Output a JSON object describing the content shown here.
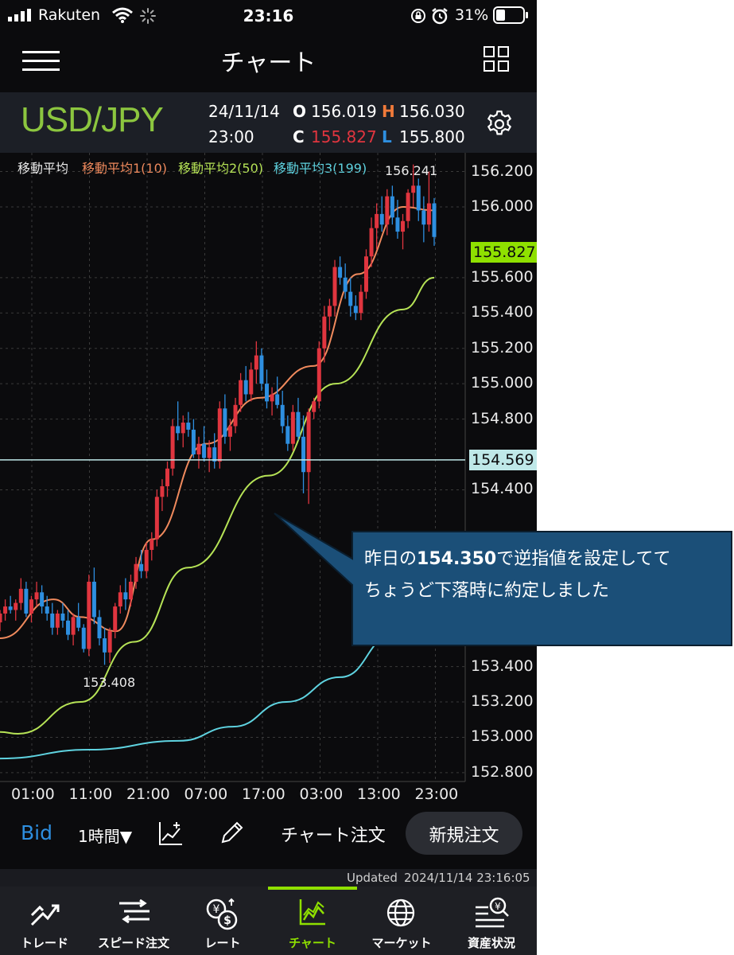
{
  "status": {
    "carrier": "Rakuten",
    "time": "23:16",
    "battery": "31%"
  },
  "header": {
    "title": "チャート"
  },
  "quote": {
    "pair": "USD/JPY",
    "date": "24/11/14",
    "time": "23:00",
    "open_label": "O",
    "open": "156.019",
    "high_label": "H",
    "high": "156.030",
    "close_label": "C",
    "close": "155.827",
    "low_label": "L",
    "low": "155.800"
  },
  "legend": {
    "title": "移動平均",
    "ma1": "移動平均1(10)",
    "ma2": "移動平均2(50)",
    "ma3": "移動平均3(199)"
  },
  "colors": {
    "up": "#e0353f",
    "down": "#2e8fe0",
    "ma1": "#f08a5d",
    "ma2": "#b6e356",
    "ma3": "#5fd3e0",
    "accent": "#8cc63f"
  },
  "chart_data": {
    "type": "candlestick",
    "y_ticks": [
      "156.200",
      "156.000",
      "155.600",
      "155.400",
      "155.200",
      "155.000",
      "154.800",
      "154.400",
      "153.400",
      "153.200",
      "153.000",
      "152.800"
    ],
    "x_ticks": [
      "01:00",
      "11:00",
      "21:00",
      "07:00",
      "17:00",
      "03:00",
      "13:00",
      "23:00"
    ],
    "ylim": [
      152.75,
      156.27
    ],
    "high_label": "156.241",
    "low_label": "153.408",
    "current_price": "155.827",
    "line_price": "154.569",
    "line_price_value": 154.569,
    "candles": [
      [
        153.65,
        153.72,
        153.6,
        153.7
      ],
      [
        153.7,
        153.78,
        153.66,
        153.74
      ],
      [
        153.74,
        153.8,
        153.7,
        153.72
      ],
      [
        153.72,
        153.78,
        153.66,
        153.76
      ],
      [
        153.76,
        153.9,
        153.72,
        153.84
      ],
      [
        153.84,
        153.88,
        153.68,
        153.7
      ],
      [
        153.7,
        153.8,
        153.65,
        153.78
      ],
      [
        153.78,
        153.88,
        153.74,
        153.82
      ],
      [
        153.82,
        153.86,
        153.7,
        153.74
      ],
      [
        153.74,
        153.8,
        153.66,
        153.7
      ],
      [
        153.7,
        153.76,
        153.58,
        153.62
      ],
      [
        153.62,
        153.72,
        153.58,
        153.7
      ],
      [
        153.7,
        153.76,
        153.62,
        153.66
      ],
      [
        153.66,
        153.72,
        153.55,
        153.58
      ],
      [
        153.58,
        153.7,
        153.52,
        153.68
      ],
      [
        153.68,
        153.76,
        153.6,
        153.62
      ],
      [
        153.62,
        153.64,
        153.48,
        153.5
      ],
      [
        153.5,
        153.92,
        153.46,
        153.88
      ],
      [
        153.88,
        153.96,
        153.64,
        153.68
      ],
      [
        153.68,
        153.72,
        153.52,
        153.56
      ],
      [
        153.56,
        153.62,
        153.41,
        153.48
      ],
      [
        153.48,
        153.62,
        153.42,
        153.6
      ],
      [
        153.6,
        153.76,
        153.56,
        153.74
      ],
      [
        153.74,
        153.86,
        153.7,
        153.82
      ],
      [
        153.82,
        153.9,
        153.72,
        153.78
      ],
      [
        153.78,
        153.92,
        153.74,
        153.88
      ],
      [
        153.88,
        154.02,
        153.84,
        153.98
      ],
      [
        153.98,
        154.06,
        153.9,
        153.94
      ],
      [
        153.94,
        154.1,
        153.9,
        154.06
      ],
      [
        154.06,
        154.16,
        154.0,
        154.12
      ],
      [
        154.12,
        154.4,
        154.08,
        154.36
      ],
      [
        154.36,
        154.46,
        154.28,
        154.42
      ],
      [
        154.42,
        154.56,
        154.36,
        154.52
      ],
      [
        154.52,
        154.8,
        154.48,
        154.76
      ],
      [
        154.76,
        154.9,
        154.68,
        154.72
      ],
      [
        154.72,
        154.82,
        154.64,
        154.78
      ],
      [
        154.78,
        154.84,
        154.7,
        154.74
      ],
      [
        154.74,
        154.8,
        154.58,
        154.6
      ],
      [
        154.6,
        154.7,
        154.52,
        154.66
      ],
      [
        154.66,
        154.76,
        154.56,
        154.58
      ],
      [
        154.58,
        154.68,
        154.5,
        154.64
      ],
      [
        154.64,
        154.72,
        154.52,
        154.56
      ],
      [
        154.56,
        154.9,
        154.52,
        154.86
      ],
      [
        154.86,
        154.94,
        154.66,
        154.7
      ],
      [
        154.7,
        154.8,
        154.62,
        154.76
      ],
      [
        154.76,
        154.92,
        154.72,
        154.88
      ],
      [
        154.88,
        155.06,
        154.84,
        155.02
      ],
      [
        155.02,
        155.1,
        154.9,
        154.94
      ],
      [
        154.94,
        155.12,
        154.9,
        155.08
      ],
      [
        155.08,
        155.24,
        155.0,
        155.16
      ],
      [
        155.16,
        155.2,
        154.96,
        155.0
      ],
      [
        155.0,
        155.08,
        154.86,
        154.9
      ],
      [
        154.9,
        154.98,
        154.82,
        154.94
      ],
      [
        154.94,
        155.04,
        154.86,
        154.88
      ],
      [
        154.88,
        154.96,
        154.72,
        154.76
      ],
      [
        154.76,
        154.82,
        154.62,
        154.66
      ],
      [
        154.66,
        154.88,
        154.62,
        154.84
      ],
      [
        154.84,
        154.92,
        154.68,
        154.7
      ],
      [
        154.7,
        154.82,
        154.38,
        154.5
      ],
      [
        154.5,
        154.86,
        154.32,
        154.84
      ],
      [
        154.84,
        154.92,
        154.8,
        154.9
      ],
      [
        154.9,
        155.24,
        154.86,
        155.2
      ],
      [
        155.2,
        155.44,
        155.12,
        155.38
      ],
      [
        155.38,
        155.48,
        155.3,
        155.44
      ],
      [
        155.44,
        155.7,
        155.38,
        155.66
      ],
      [
        155.66,
        155.72,
        155.56,
        155.6
      ],
      [
        155.6,
        155.68,
        155.48,
        155.52
      ],
      [
        155.52,
        155.6,
        155.38,
        155.44
      ],
      [
        155.44,
        155.5,
        155.36,
        155.4
      ],
      [
        155.4,
        155.56,
        155.36,
        155.52
      ],
      [
        155.52,
        155.76,
        155.48,
        155.72
      ],
      [
        155.72,
        155.94,
        155.66,
        155.88
      ],
      [
        155.88,
        156.02,
        155.76,
        155.96
      ],
      [
        155.96,
        156.06,
        155.86,
        155.9
      ],
      [
        155.9,
        156.1,
        155.84,
        156.06
      ],
      [
        156.06,
        156.12,
        155.9,
        155.94
      ],
      [
        155.94,
        156.04,
        155.82,
        155.86
      ],
      [
        155.86,
        155.96,
        155.76,
        155.92
      ],
      [
        155.92,
        156.1,
        155.88,
        156.08
      ],
      [
        156.08,
        156.24,
        156.0,
        156.12
      ],
      [
        156.12,
        156.16,
        155.92,
        155.98
      ],
      [
        155.98,
        156.06,
        155.8,
        155.9
      ],
      [
        155.9,
        156.2,
        155.86,
        156.02
      ],
      [
        156.02,
        156.05,
        155.78,
        155.83
      ]
    ],
    "ma1": [
      [
        0,
        153.56
      ],
      [
        12,
        153.78
      ],
      [
        18,
        153.68
      ],
      [
        26,
        153.6
      ],
      [
        34,
        154.12
      ],
      [
        46,
        154.66
      ],
      [
        58,
        154.92
      ],
      [
        70,
        155.1
      ],
      [
        80,
        155.62
      ],
      [
        90,
        156.0
      ],
      [
        97,
        155.98
      ]
    ],
    "ma2": [
      [
        0,
        153.03
      ],
      [
        4,
        153.02
      ],
      [
        18,
        153.2
      ],
      [
        30,
        153.54
      ],
      [
        42,
        153.96
      ],
      [
        60,
        154.48
      ],
      [
        75,
        155.0
      ],
      [
        90,
        155.42
      ],
      [
        97,
        155.6
      ]
    ],
    "ma3": [
      [
        0,
        152.88
      ],
      [
        20,
        152.93
      ],
      [
        40,
        152.98
      ],
      [
        52,
        153.06
      ],
      [
        64,
        153.2
      ],
      [
        76,
        153.34
      ],
      [
        88,
        153.58
      ],
      [
        97,
        153.72
      ]
    ]
  },
  "toolbar": {
    "bid": "Bid",
    "interval": "1時間▼",
    "chart_order": "チャート注文",
    "new_order": "新規注文"
  },
  "updated": {
    "label": "Updated",
    "value": "2024/11/14 23:16:05"
  },
  "tabs": [
    "トレード",
    "スピード注文",
    "レート",
    "チャート",
    "マーケット",
    "資産状況"
  ],
  "callout": {
    "line1_prefix": "昨日の",
    "line1_price": "154.350",
    "line1_suffix": "で逆指値を設定してて",
    "line2": "ちょうど下落時に約定しました"
  }
}
